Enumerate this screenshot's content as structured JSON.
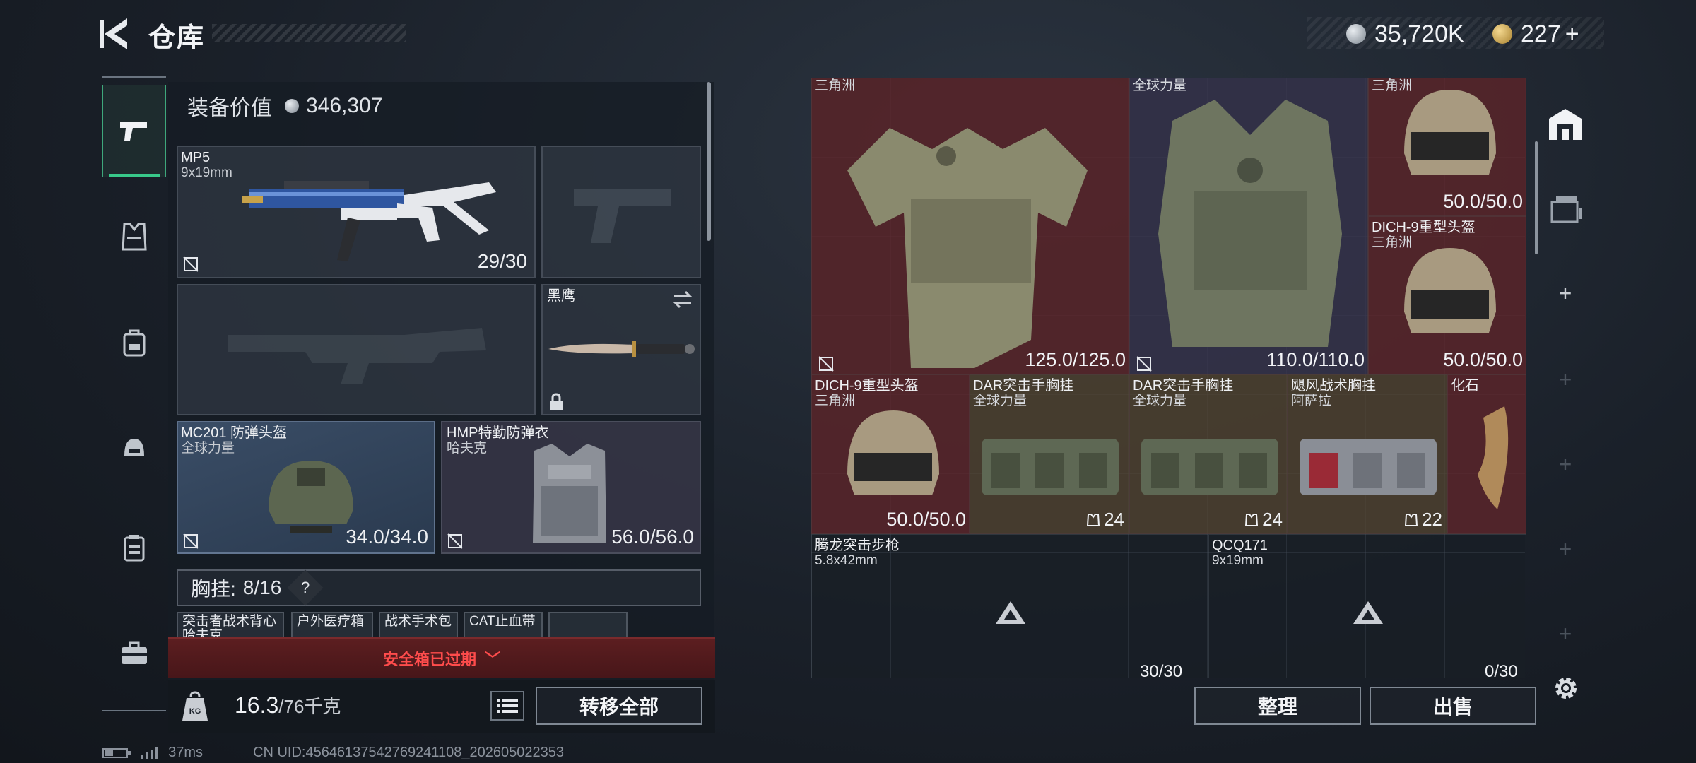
{
  "header": {
    "title": "仓库",
    "currency_silver": "35,720K",
    "currency_gold": "227",
    "currency_gold_plus": "+"
  },
  "nav": [
    {
      "name": "weapons",
      "icon": "pistol-icon",
      "active": true
    },
    {
      "name": "armor",
      "icon": "vest-icon"
    },
    {
      "name": "backpack",
      "icon": "backpack-icon"
    },
    {
      "name": "helmet",
      "icon": "helmet-icon"
    },
    {
      "name": "rig",
      "icon": "rig-icon"
    },
    {
      "name": "case",
      "icon": "briefcase-icon"
    }
  ],
  "loadout": {
    "value_label": "装备价值",
    "value_amount": "346,307",
    "primary": {
      "name": "MP5",
      "caliber": "9x19mm",
      "ammo": "29/30"
    },
    "melee": {
      "name": "黑鹰"
    },
    "helmet": {
      "name": "MC201 防弹头盔",
      "brand": "全球力量",
      "durability": "34.0/34.0"
    },
    "armor": {
      "name": "HMP特勤防弹衣",
      "brand": "哈夫克",
      "durability": "56.0/56.0"
    },
    "rig": {
      "label": "胸挂:",
      "used": "8",
      "total": "/16",
      "help": "?"
    },
    "rig_items": [
      "突击者战术背心",
      "户外医疗箱",
      "战术手术包",
      "CAT止血带"
    ],
    "rig_item_sub": "哈夫克",
    "expired_text": "安全箱已过期",
    "weight": "16.3",
    "weight_max": "/76千克",
    "kg_icon_text": "KG",
    "transfer_all": "转移全部"
  },
  "storage": {
    "items": [
      {
        "id": "armor1",
        "sub": "三角洲",
        "durability": "125.0/125.0"
      },
      {
        "id": "armor2",
        "sub": "全球力量",
        "durability": "110.0/110.0"
      },
      {
        "id": "helmet_top",
        "sub": "三角洲",
        "durability": "50.0/50.0"
      },
      {
        "id": "helmet_mid",
        "name": "DICH-9重型头盔",
        "sub": "三角洲",
        "durability": "50.0/50.0"
      },
      {
        "id": "helmet_low",
        "name": "DICH-9重型头盔",
        "sub": "三角洲",
        "durability": "50.0/50.0"
      },
      {
        "id": "rig1",
        "name": "DAR突击手胸挂",
        "sub": "全球力量",
        "capacity": "24"
      },
      {
        "id": "rig2",
        "name": "DAR突击手胸挂",
        "sub": "全球力量",
        "capacity": "24"
      },
      {
        "id": "rig3",
        "name": "飓风战术胸挂",
        "sub": "阿萨拉",
        "capacity": "22"
      },
      {
        "id": "fossil",
        "name": "化石"
      },
      {
        "id": "rifle",
        "name": "腾龙突击步枪",
        "sub": "5.8x42mm",
        "ammo": "30/30"
      },
      {
        "id": "smg",
        "name": "QCQ171",
        "sub": "9x19mm",
        "ammo": "0/30"
      }
    ],
    "sort_button": "整理",
    "sell_button": "出售"
  },
  "status": {
    "ping": "37ms",
    "uid": "CN UID:456461375427692411​08_202605022353"
  },
  "colors": {
    "accent_green": "#38c98a",
    "expired_red": "#ff4c4c",
    "rarity_red": "#60262c",
    "rarity_violet": "#3a3650",
    "rarity_brown": "#564632"
  }
}
